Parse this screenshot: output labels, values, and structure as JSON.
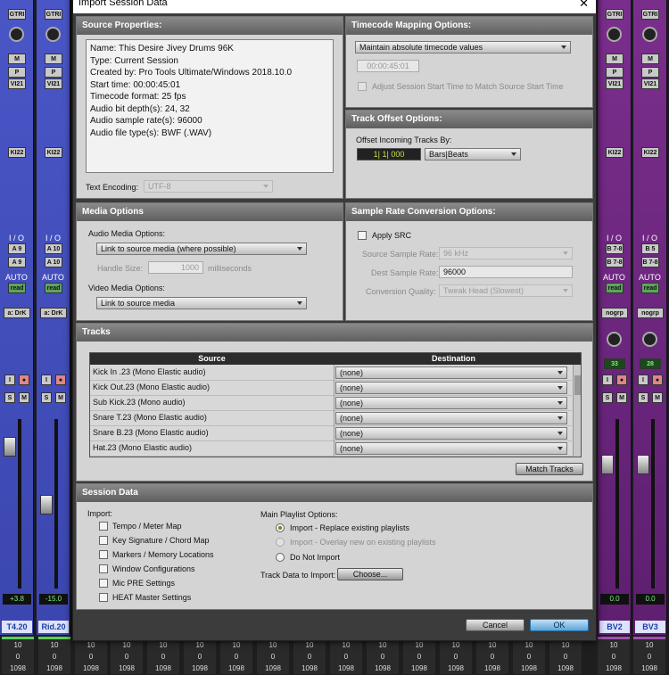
{
  "dialog": {
    "title": "Import Session Data",
    "close": "✕",
    "source_properties": {
      "header": "Source Properties:",
      "lines": [
        "Name: This Desire Jivey Drums 96K",
        "Type: Current Session",
        "Created by: Pro Tools Ultimate/Windows 2018.10.0",
        "Start time: 00:00:45:01",
        "Timecode format: 25 fps",
        "Audio bit depth(s): 24, 32",
        "Audio sample rate(s): 96000",
        "Audio file type(s): BWF (.WAV)"
      ],
      "text_encoding_label": "Text Encoding:",
      "text_encoding_value": "UTF-8"
    },
    "timecode_mapping": {
      "header": "Timecode Mapping Options:",
      "mode": "Maintain absolute timecode values",
      "timecode": "00:00:45:01",
      "adjust_label": "Adjust Session Start Time to Match Source Start Time"
    },
    "track_offset": {
      "header": "Track Offset Options:",
      "offset_label": "Offset Incoming Tracks By:",
      "offset_value": "1| 1| 000",
      "units": "Bars|Beats"
    },
    "media_options": {
      "header": "Media Options",
      "audio_label": "Audio Media Options:",
      "audio_value": "Link to source media (where possible)",
      "handle_label": "Handle Size:",
      "handle_value": "1000",
      "handle_units": "milliseconds",
      "video_label": "Video Media Options:",
      "video_value": "Link to source media"
    },
    "sample_rate": {
      "header": "Sample Rate Conversion Options:",
      "apply_src": "Apply SRC",
      "source_rate_label": "Source Sample Rate:",
      "source_rate_value": "96 kHz",
      "dest_rate_label": "Dest Sample Rate:",
      "dest_rate_value": "96000",
      "quality_label": "Conversion Quality:",
      "quality_value": "Tweak Head (Slowest)"
    },
    "tracks": {
      "header": "Tracks",
      "col_source": "Source",
      "col_destination": "Destination",
      "rows": [
        {
          "source": "Kick In .23 (Mono Elastic audio)",
          "destination": "(none)"
        },
        {
          "source": "Kick Out.23 (Mono Elastic audio)",
          "destination": "(none)"
        },
        {
          "source": "Sub Kick.23 (Mono audio)",
          "destination": "(none)"
        },
        {
          "source": "Snare T.23 (Mono Elastic audio)",
          "destination": "(none)"
        },
        {
          "source": "Snare B.23 (Mono Elastic audio)",
          "destination": "(none)"
        },
        {
          "source": "Hat.23 (Mono Elastic audio)",
          "destination": "(none)"
        }
      ],
      "match_button": "Match Tracks"
    },
    "session_data": {
      "header": "Session Data",
      "import_label": "Import:",
      "checkboxes": [
        "Tempo / Meter Map",
        "Key Signature / Chord Map",
        "Markers / Memory Locations",
        "Window Configurations",
        "Mic PRE Settings",
        "HEAT Master Settings"
      ],
      "playlist_label": "Main Playlist Options:",
      "playlist_options": [
        "Import - Replace existing playlists",
        "Import - Overlay new on existing playlists",
        "Do Not Import"
      ],
      "track_data_label": "Track Data to Import:",
      "choose_button": "Choose..."
    },
    "cancel": "Cancel",
    "ok": "OK"
  },
  "mixer": {
    "left_strips": [
      {
        "top_label": "GTRI",
        "insert": "VI21",
        "insert2": "KI22",
        "io": "I / O",
        "in": "A 9",
        "out": "A 9",
        "auto": "AUTO",
        "mode": "read",
        "group": "a: DrK",
        "value": "+3.8",
        "name": "T4.20"
      },
      {
        "top_label": "GTRI",
        "insert": "VI21",
        "insert2": "KI22",
        "io": "I / O",
        "in": "A 10",
        "out": "A 10",
        "auto": "AUTO",
        "mode": "read",
        "group": "a: DrK",
        "value": "-15.0",
        "name": "Rid.20"
      }
    ],
    "right_strips": [
      {
        "top_label": "GTRI",
        "insert": "VI21",
        "insert2": "KI22",
        "io": "I / O",
        "in": "B 7-8",
        "out": "B 7-8",
        "auto": "AUTO",
        "mode": "read",
        "group": "nogrp",
        "meter": "33",
        "value": "0.0",
        "name": "BV2"
      },
      {
        "top_label": "GTRI",
        "insert": "VI21",
        "insert2": "KI22",
        "io": "I / O",
        "in": "B 5",
        "out": "B 7-8",
        "auto": "AUTO",
        "mode": "read",
        "group": "nogrp",
        "meter": "28",
        "value": "0.0",
        "name": "BV3"
      }
    ],
    "bottom_values": [
      "10",
      "0",
      "1098"
    ]
  }
}
